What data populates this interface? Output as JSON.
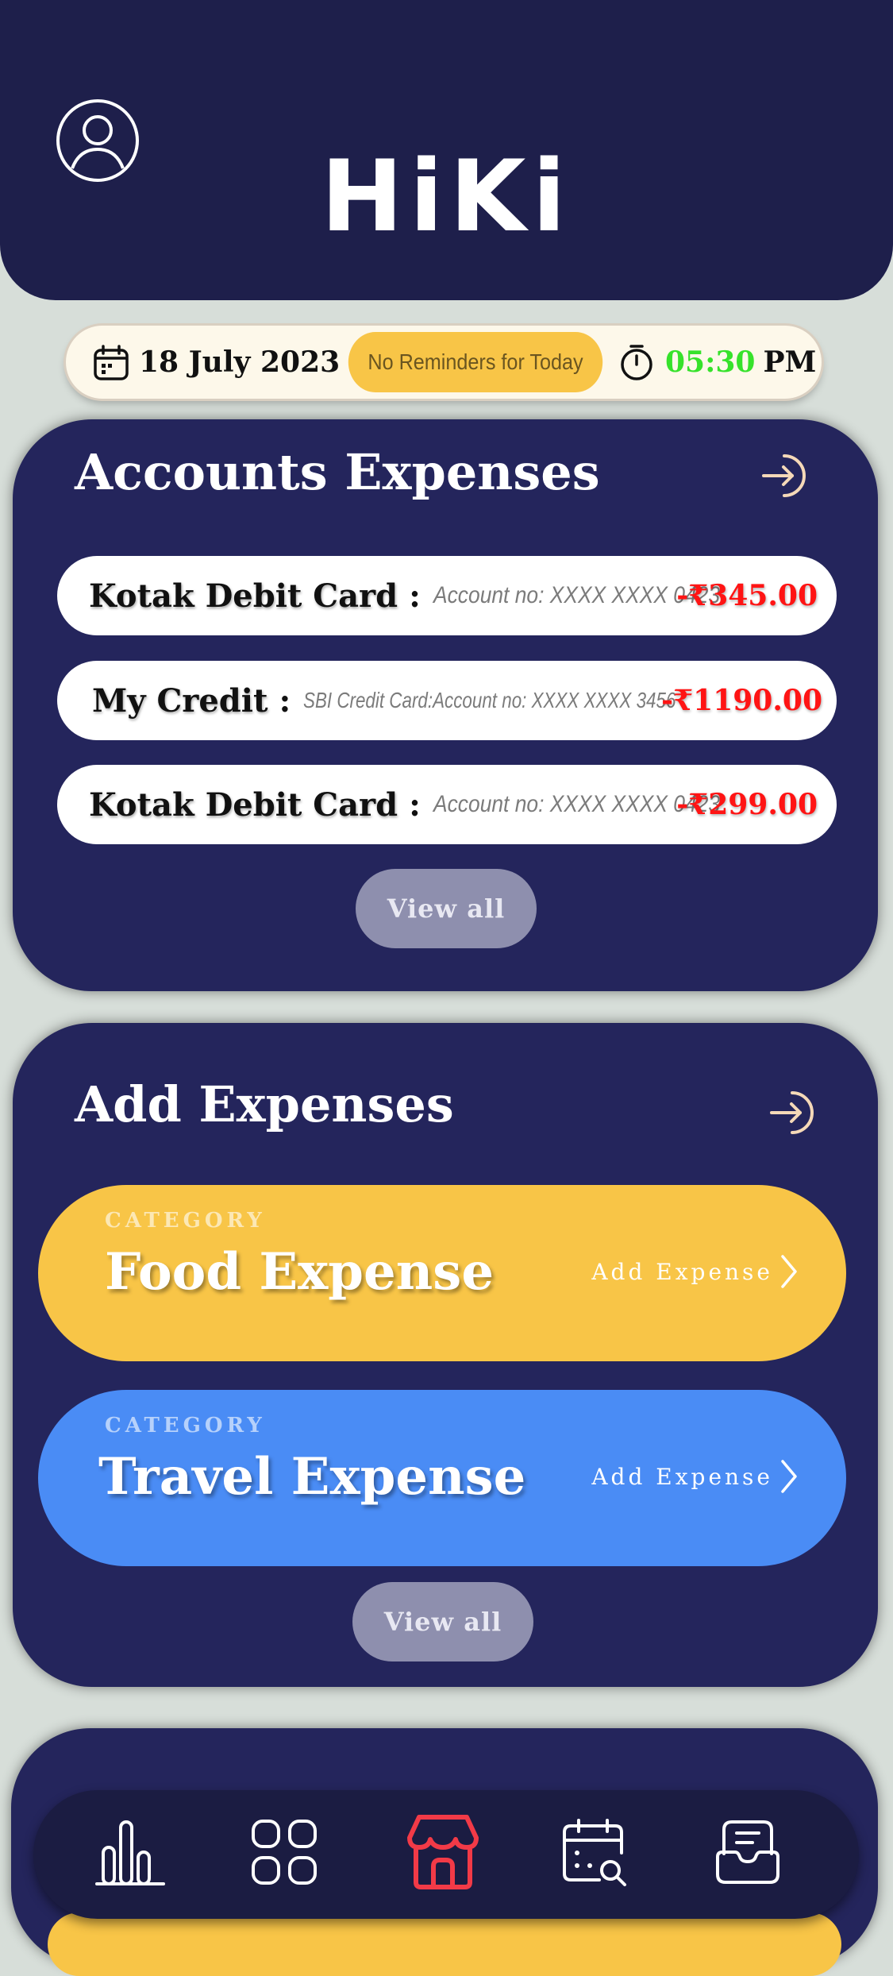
{
  "header": {
    "app_title": "HiKi",
    "profile_icon": "user-circle-icon"
  },
  "status_bar": {
    "date": "18 July 2023",
    "reminder": "No Reminders for Today",
    "time_value": "05:30",
    "time_period": "PM",
    "icons": [
      "calendar-icon",
      "stopwatch-icon"
    ]
  },
  "accounts_panel": {
    "title": "Accounts Expenses",
    "open_icon": "arrow-enter-icon",
    "items": [
      {
        "name": "Kotak Debit Card",
        "separator": ":",
        "meta": "Account no: XXXX XXXX 0423",
        "amount": "-₹345.00"
      },
      {
        "name": "My Credit",
        "separator": ":",
        "meta": "SBI Credit Card:Account no: XXXX XXXX 3456",
        "amount": "-₹1190.00"
      },
      {
        "name": "Kotak Debit Card",
        "separator": ":",
        "meta": "Account no: XXXX XXXX 0423",
        "amount": "-₹299.00"
      }
    ],
    "view_all_label": "View all"
  },
  "add_panel": {
    "title": "Add Expenses",
    "open_icon": "arrow-enter-icon",
    "categories": [
      {
        "label": "CATEGORY",
        "name": "Food Expense",
        "action": "Add Expense",
        "color": "#F8C547"
      },
      {
        "label": "CATEGORY",
        "name": "Travel Expense",
        "action": "Add Expense",
        "color": "#4A8CF5"
      }
    ],
    "view_all_label": "View all"
  },
  "nav": {
    "items": [
      "bar-chart-icon",
      "grid-icon",
      "store-icon",
      "calendar-search-icon",
      "inbox-icon"
    ],
    "active_index": 2,
    "active_color": "#F23A47"
  },
  "colors": {
    "navy": "#1E1F4B",
    "panel": "#24255C",
    "amount_red": "#FF1414",
    "time_green": "#36E22B"
  }
}
